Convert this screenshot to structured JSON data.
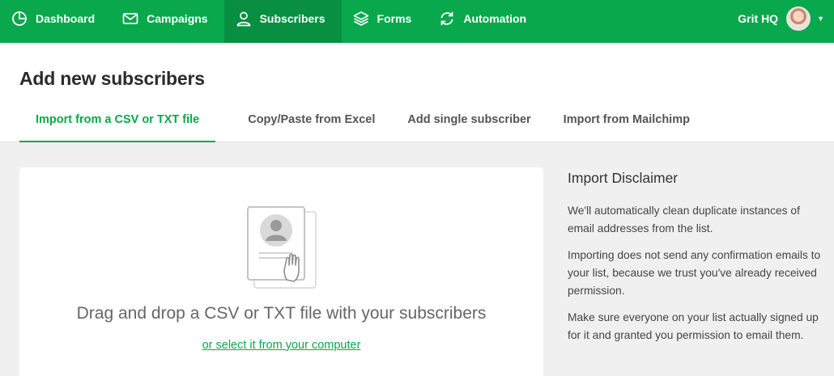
{
  "nav": {
    "items": [
      {
        "label": "Dashboard",
        "icon": "dashboard-icon"
      },
      {
        "label": "Campaigns",
        "icon": "envelope-icon"
      },
      {
        "label": "Subscribers",
        "icon": "user-icon"
      },
      {
        "label": "Forms",
        "icon": "layers-icon"
      },
      {
        "label": "Automation",
        "icon": "refresh-icon"
      }
    ],
    "account_name": "Grit HQ",
    "accent_color": "#09a84c"
  },
  "page": {
    "title": "Add new subscribers"
  },
  "tabs": [
    {
      "label": "Import from a CSV or TXT file",
      "active": true
    },
    {
      "label": "Copy/Paste from Excel",
      "active": false
    },
    {
      "label": "Add single subscriber",
      "active": false
    },
    {
      "label": "Import from Mailchimp",
      "active": false
    }
  ],
  "dropzone": {
    "instruction": "Drag and drop a CSV or TXT file with your subscribers",
    "select_link": "or select it from your computer"
  },
  "disclaimer": {
    "title": "Import Disclaimer",
    "paragraphs": [
      "We'll automatically clean duplicate instances of email addresses from the list.",
      "Importing does not send any confirmation emails to your list, because we trust you've already received permission.",
      "Make sure everyone on your list actually signed up for it and granted you permission to email them."
    ]
  }
}
